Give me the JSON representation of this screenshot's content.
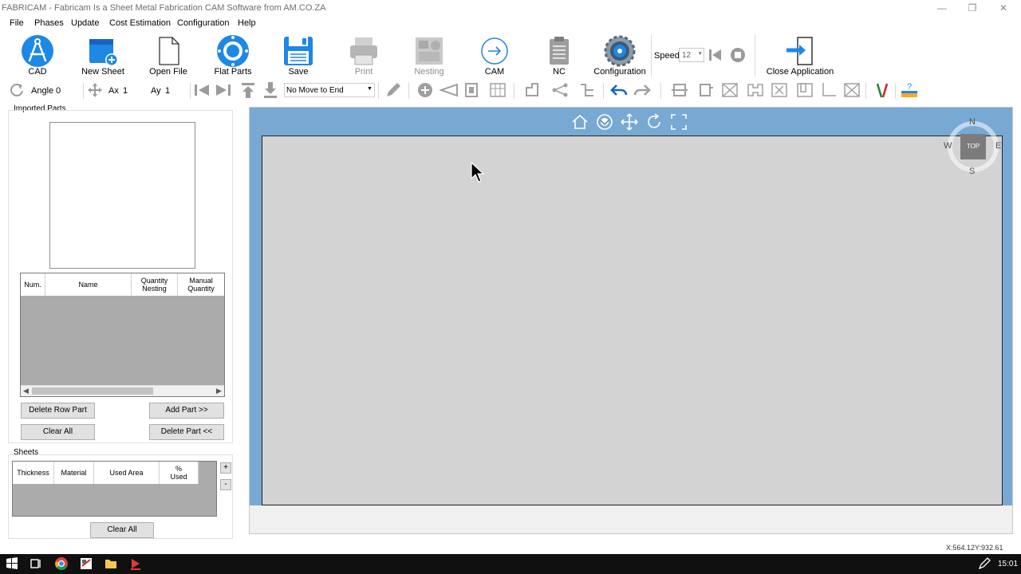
{
  "window": {
    "title": "FABRICAM - Fabricam Is a Sheet Metal Fabrication CAM Software from AM.CO.ZA",
    "controls": [
      "minimize",
      "restore",
      "close"
    ]
  },
  "menu": [
    "File",
    "Phases",
    "Update",
    "Cost Estimation",
    "Configuration",
    "Help"
  ],
  "toolbar": {
    "cad": "CAD",
    "new_sheet": "New Sheet",
    "open_file": "Open File",
    "flat_parts": "Flat Parts",
    "save": "Save",
    "print": "Print",
    "nesting": "Nesting",
    "cam": "CAM",
    "nc": "NC",
    "configuration": "Configuration",
    "speed_label": "Speed",
    "speed_value": "12",
    "close_application": "Close Application"
  },
  "secondary_toolbar": {
    "angle_label": "Angle",
    "angle_value": "0",
    "ax_label": "Ax",
    "ax_value": "1",
    "ay_label": "Ay",
    "ay_value": "1",
    "move_option": "No Move to End"
  },
  "left_panel": {
    "imported_parts_label": "Imported Parts",
    "parts_table": {
      "columns": [
        "Num.",
        "Name",
        "Quantity Nesting",
        "Manual Quantity"
      ],
      "rows": []
    },
    "buttons": {
      "delete_row_part": "Delete Row Part",
      "add_part": "Add Part >>",
      "clear_all": "Clear All",
      "delete_part": "Delete Part <<"
    },
    "sheets_label": "Sheets",
    "sheets_table": {
      "columns": [
        "Thickness",
        "Material",
        "Used Area",
        "% Used"
      ],
      "rows": []
    },
    "sheets_plus": "+",
    "sheets_minus": "-",
    "sheets_clear_all": "Clear All"
  },
  "viewport": {
    "compass": {
      "n": "N",
      "s": "S",
      "e": "E",
      "w": "W",
      "view": "TOP"
    }
  },
  "status": {
    "coordinates": "X:564.12Y:932.61"
  },
  "taskbar": {
    "time": "15:01"
  },
  "colors": {
    "accent_blue": "#1e88e5",
    "viewport_blue": "#77a9d3",
    "canvas_gray": "#d3d3d3"
  }
}
